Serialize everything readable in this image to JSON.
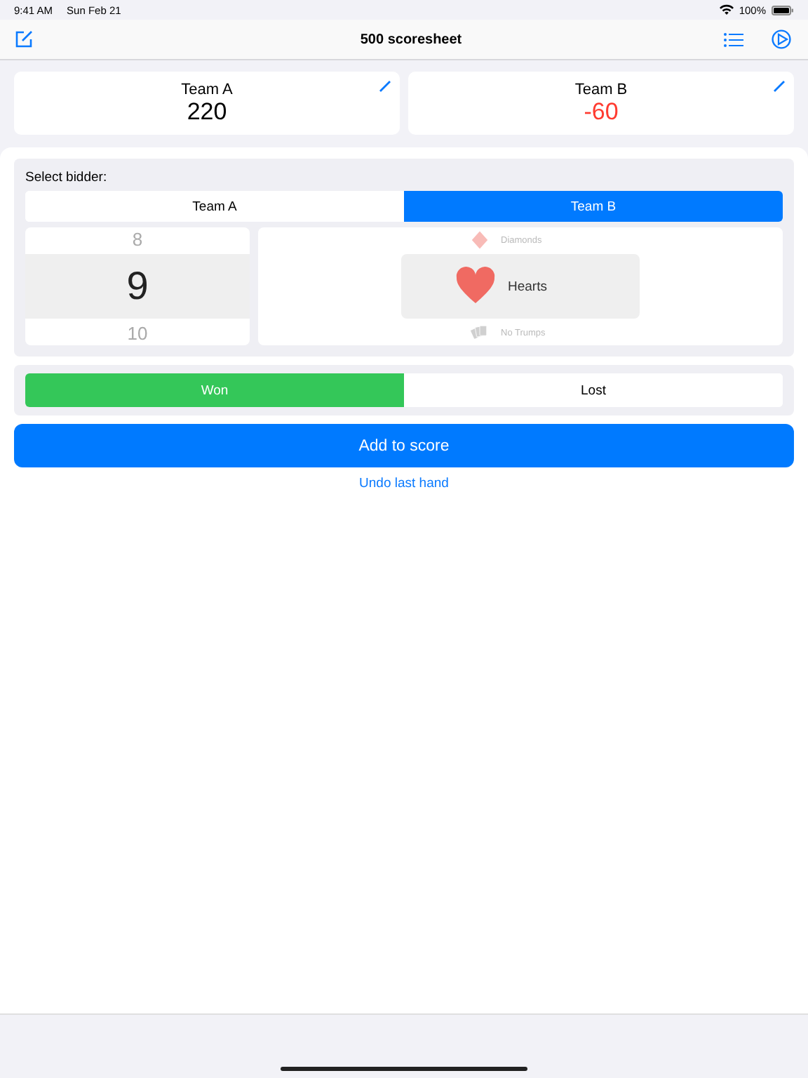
{
  "status_bar": {
    "time": "9:41 AM",
    "date": "Sun Feb 21",
    "battery": "100%"
  },
  "nav": {
    "title": "500 scoresheet"
  },
  "teams": [
    {
      "name": "Team A",
      "score": "220",
      "negative": false
    },
    {
      "name": "Team B",
      "score": "-60",
      "negative": true
    }
  ],
  "bidder": {
    "label": "Select bidder:",
    "options": [
      {
        "label": "Team A",
        "selected": false
      },
      {
        "label": "Team B",
        "selected": true
      }
    ]
  },
  "tricks": [
    {
      "value": "8",
      "selected": false
    },
    {
      "value": "9",
      "selected": true
    },
    {
      "value": "10",
      "selected": false
    }
  ],
  "suits": [
    {
      "kind": "diamond",
      "label": "Diamonds",
      "selected": false
    },
    {
      "kind": "heart",
      "label": "Hearts",
      "selected": true
    },
    {
      "kind": "cards",
      "label": "No Trumps",
      "selected": false
    }
  ],
  "result": [
    {
      "label": "Won",
      "selected": true
    },
    {
      "label": "Lost",
      "selected": false
    }
  ],
  "add_button": "Add to score",
  "undo_link": "Undo last hand"
}
